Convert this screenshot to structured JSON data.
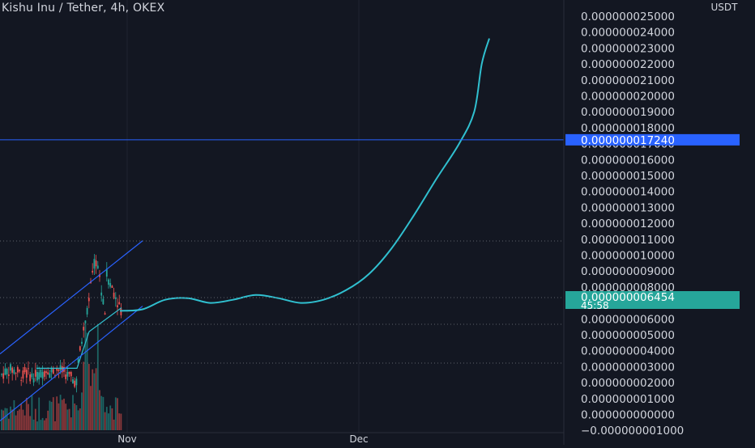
{
  "header": {
    "symbol": "Kishu Inu / Tether, 4h, OKEX"
  },
  "chart_data": {
    "type": "candlestick",
    "title": "Kishu Inu / Tether, 4h, OKEX",
    "currency_label": "USDT",
    "y_ticks": [
      "0.000000025000",
      "0.000000024000",
      "0.000000023000",
      "0.000000022000",
      "0.000000021000",
      "0.000000020000",
      "0.000000019000",
      "0.000000018000",
      "0.000000017000",
      "0.000000016000",
      "0.000000015000",
      "0.000000014000",
      "0.000000013000",
      "0.000000012000",
      "0.000000011000",
      "0.000000010000",
      "0.000000009000",
      "0.000000008000",
      "0.000000007000",
      "0.000000006000",
      "0.000000005000",
      "0.000000004000",
      "0.000000003000",
      "0.000000002000",
      "0.000000001000",
      "0.000000000000",
      "−0.000000001000"
    ],
    "y_values": [
      25,
      24,
      23,
      22,
      21,
      20,
      19,
      18,
      17,
      16,
      15,
      14,
      13,
      12,
      11,
      10,
      9,
      8,
      7,
      6,
      5,
      4,
      3,
      2,
      1,
      0,
      -1
    ],
    "y_unit_scale": "1e-9",
    "x_ticks": [
      "Nov",
      "Dec"
    ],
    "horizontal_line_price": "0.000000017240",
    "last_price": "0.000000006454",
    "countdown": "45:58",
    "colors": {
      "background": "#131722",
      "up": "#26a69a",
      "down": "#ef5350",
      "projection": "#30c0d0",
      "channel": "#2962ff",
      "price_line": "#2962ff",
      "last_price_badge": "#26a69a",
      "hline_badge": "#2962ff"
    },
    "projection_curve": [
      [
        0,
        6.5
      ],
      [
        3,
        6.6
      ],
      [
        6,
        7.2
      ],
      [
        9,
        7.3
      ],
      [
        12,
        7.0
      ],
      [
        15,
        7.2
      ],
      [
        18,
        7.5
      ],
      [
        21,
        7.3
      ],
      [
        24,
        7.0
      ],
      [
        27,
        7.2
      ],
      [
        30,
        7.8
      ],
      [
        33,
        8.8
      ],
      [
        36,
        10.4
      ],
      [
        39,
        12.5
      ],
      [
        42,
        14.8
      ],
      [
        45,
        17.0
      ],
      [
        47,
        19.0
      ],
      [
        48,
        22.0
      ],
      [
        49,
        23.6
      ]
    ],
    "candles_summary": "price rises from ~2.5 to ~10.0 (x1e-9) just before Nov, then falls to ~6.5"
  }
}
